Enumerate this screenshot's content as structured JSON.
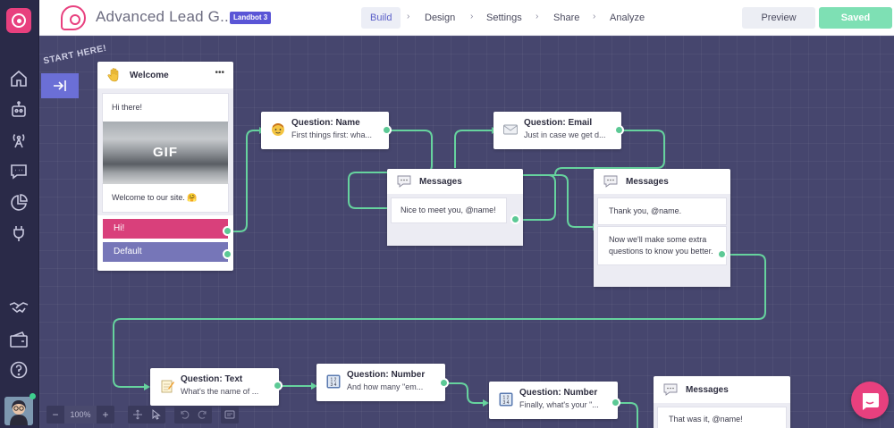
{
  "app": {
    "bot_title": "Advanced Lead G...",
    "badge": "Landbot 3"
  },
  "nav": {
    "tabs": [
      {
        "label": "Build",
        "active": true
      },
      {
        "label": "Design"
      },
      {
        "label": "Settings"
      },
      {
        "label": "Share"
      },
      {
        "label": "Analyze"
      }
    ],
    "chevron": "›"
  },
  "actions": {
    "preview_label": "Preview",
    "saved_label": "Saved"
  },
  "sidebar": {
    "icons": [
      "home-icon",
      "bot-icon",
      "broadcast-icon",
      "chat-icon",
      "analytics-icon",
      "integrations-icon",
      "handshake-icon",
      "billing-icon",
      "help-icon"
    ]
  },
  "canvas": {
    "start_label": "START HERE!",
    "nodes": {
      "welcome": {
        "title": "Welcome",
        "menu": "•••",
        "greeting": "Hi there!",
        "gif_label": "GIF",
        "message": "Welcome to our site. 🤗",
        "buttons": [
          "Hi!",
          "Default"
        ]
      },
      "q_name": {
        "title": "Question: Name",
        "subtitle": "First things first: wha..."
      },
      "q_email": {
        "title": "Question: Email",
        "subtitle": "Just in case we get d..."
      },
      "msg1": {
        "title": "Messages",
        "bubble": "Nice to meet you, @name!"
      },
      "msg2": {
        "title": "Messages",
        "bubble1": "Thank you, @name.",
        "bubble2": "Now we'll make some extra questions to know you better."
      },
      "q_text": {
        "title": "Question: Text",
        "subtitle": "What's the name of ..."
      },
      "q_number1": {
        "title": "Question: Number",
        "subtitle": "And how many \"em..."
      },
      "q_number2": {
        "title": "Question: Number",
        "subtitle": "Finally, what's your \"..."
      },
      "msg3": {
        "title": "Messages",
        "bubble": "That was it, @name!"
      }
    }
  },
  "toolbar": {
    "zoom_out": "−",
    "zoom_level": "100%",
    "zoom_in": "+"
  },
  "colors": {
    "brand_pink": "#e8407e",
    "accent_purple": "#5a55d6",
    "connector_green": "#5cc995",
    "canvas_bg": "#46466e"
  }
}
